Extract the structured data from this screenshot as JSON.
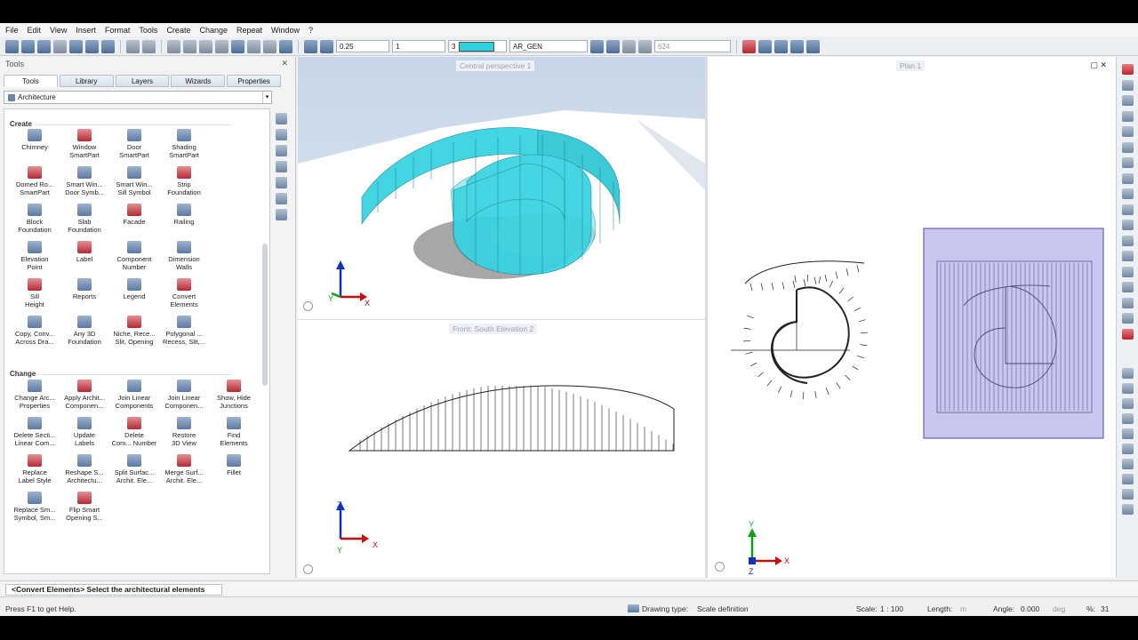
{
  "menu": [
    "File",
    "Edit",
    "View",
    "Insert",
    "Format",
    "Tools",
    "Create",
    "Change",
    "Repeat",
    "Window",
    "?"
  ],
  "toolbar": {
    "pen_thickness": "0.25",
    "line_type": "1",
    "color_index": "3",
    "color_hex": "#2fd0e0",
    "layer": "AR_GEN",
    "search_value": "624"
  },
  "panel": {
    "title": "Tools",
    "controls": " ✕",
    "tabs": [
      "Tools",
      "Library",
      "Layers",
      "Wizards",
      "Properties"
    ],
    "category": "Architecture",
    "sections": {
      "create": "Create",
      "change": "Change"
    },
    "create_tools": [
      [
        "Chimney",
        ""
      ],
      [
        "Window",
        "SmartPart"
      ],
      [
        "Door",
        "SmartPart"
      ],
      [
        "Shading",
        "SmartPart"
      ],
      [
        "Domed Ro...",
        "SmartPart"
      ],
      [
        "Smart Win...",
        "Door Symb..."
      ],
      [
        "Smart Win...",
        "Sill Symbol"
      ],
      [
        "Strip",
        "Foundation"
      ],
      [
        "Block",
        "Foundation"
      ],
      [
        "Slab",
        "Foundation"
      ],
      [
        "Facade",
        ""
      ],
      [
        "Railing",
        ""
      ],
      [
        "Elevation",
        "Point"
      ],
      [
        "Label",
        ""
      ],
      [
        "Component",
        "Number"
      ],
      [
        "Dimension",
        "Walls"
      ],
      [
        "Sill",
        "Height"
      ],
      [
        "Reports",
        ""
      ],
      [
        "Legend",
        ""
      ],
      [
        "Convert",
        "Elements"
      ],
      [
        "Copy, Conv...",
        "Across Dra..."
      ],
      [
        "Any 3D",
        "Foundation"
      ],
      [
        "Niche, Rece...",
        "Slit, Opening"
      ],
      [
        "Polygonal ...",
        "Recess, Slit,..."
      ]
    ],
    "change_tools": [
      [
        "Change Arc...",
        "Properties"
      ],
      [
        "Apply Archit...",
        "Componen..."
      ],
      [
        "Join Linear",
        "Components"
      ],
      [
        "Join Linear",
        "Componen..."
      ],
      [
        "Show, Hide",
        "Junctions"
      ],
      [
        "Delete Secti...",
        "Linear Com..."
      ],
      [
        "Update",
        "Labels"
      ],
      [
        "Delete",
        "Com... Number"
      ],
      [
        "Restore",
        "3D View"
      ],
      [
        "Find",
        "Elements"
      ],
      [
        "Replace",
        "Label Style"
      ],
      [
        "Reshape S...",
        "Architectu..."
      ],
      [
        "Split Surfac...",
        "Archit. Ele..."
      ],
      [
        "Merge Surf...",
        "Archit. Ele..."
      ],
      [
        "Fillet",
        ""
      ],
      [
        "Replace Sm...",
        "Symbol, Sm..."
      ],
      [
        "Flip Smart",
        "Opening S..."
      ]
    ]
  },
  "viewports": {
    "perspective_label": "Central perspective 1",
    "front_label": "Front: South Elevation 2",
    "plan_label": "Plan 1",
    "axis_x": "X",
    "axis_y": "Y",
    "axis_z": "Z"
  },
  "command": "<Convert Elements> Select the architectural elements",
  "status": {
    "help": "Press F1 to get Help.",
    "drawing_type_label": "Drawing type:",
    "drawing_type_value": "Scale definition",
    "scale_label": "Scale:",
    "scale_value": "1 : 100",
    "length_label": "Length:",
    "length_unit": "m",
    "angle_label": "Angle:",
    "angle_value": "0.000",
    "angle_unit": "deg",
    "percent_label": "%:",
    "percent_value": "31"
  }
}
